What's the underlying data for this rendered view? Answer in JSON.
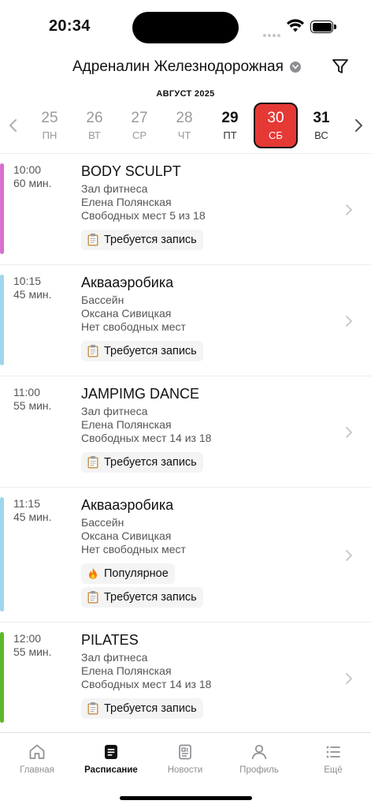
{
  "status": {
    "time": "20:34"
  },
  "header": {
    "club_name": "Адреналин Железнодорожная",
    "month": "АВГУСТ 2025"
  },
  "week": [
    {
      "num": "25",
      "dow": "ПН",
      "state": "past"
    },
    {
      "num": "26",
      "dow": "ВТ",
      "state": "past"
    },
    {
      "num": "27",
      "dow": "СР",
      "state": "past"
    },
    {
      "num": "28",
      "dow": "ЧТ",
      "state": "past"
    },
    {
      "num": "29",
      "dow": "ПТ",
      "state": "future"
    },
    {
      "num": "30",
      "dow": "СБ",
      "state": "selected"
    },
    {
      "num": "31",
      "dow": "ВС",
      "state": "future"
    }
  ],
  "classes": [
    {
      "time": "10:00",
      "duration": "60 мин.",
      "title": "BODY SCULPT",
      "room": "Зал фитнеса",
      "trainer": "Елена Полянская",
      "seats": "Свободных мест 5 из 18",
      "color": "#d96fcf",
      "badges": [
        "Требуется запись"
      ]
    },
    {
      "time": "10:15",
      "duration": "45 мин.",
      "title": "Аквааэробика",
      "room": "Бассейн",
      "trainer": "Оксана Сивицкая",
      "seats": "Нет свободных мест",
      "color": "#9fd6ea",
      "badges": [
        "Требуется запись"
      ]
    },
    {
      "time": "11:00",
      "duration": "55 мин.",
      "title": "JAMPIMG DANCE",
      "room": "Зал фитнеса",
      "trainer": "Елена Полянская",
      "seats": "Свободных мест 14 из 18",
      "color": "",
      "badges": [
        "Требуется запись"
      ]
    },
    {
      "time": "11:15",
      "duration": "45 мин.",
      "title": "Аквааэробика",
      "room": "Бассейн",
      "trainer": "Оксана Сивицкая",
      "seats": "Нет свободных мест",
      "color": "#9fd6ea",
      "badges": [
        "Популярное",
        "Требуется запись"
      ]
    },
    {
      "time": "12:00",
      "duration": "55 мин.",
      "title": "PILATES",
      "room": "Зал фитнеса",
      "trainer": "Елена Полянская",
      "seats": "Свободных мест 14 из 18",
      "color": "#5cb82a",
      "badges": [
        "Требуется запись"
      ]
    }
  ],
  "tabs": [
    {
      "label": "Главная",
      "icon": "home-icon",
      "active": false
    },
    {
      "label": "Расписание",
      "icon": "schedule-icon",
      "active": true
    },
    {
      "label": "Новости",
      "icon": "news-icon",
      "active": false
    },
    {
      "label": "Профиль",
      "icon": "profile-icon",
      "active": false
    },
    {
      "label": "Ещё",
      "icon": "more-icon",
      "active": false
    }
  ],
  "colors": {
    "accent": "#e53935"
  }
}
